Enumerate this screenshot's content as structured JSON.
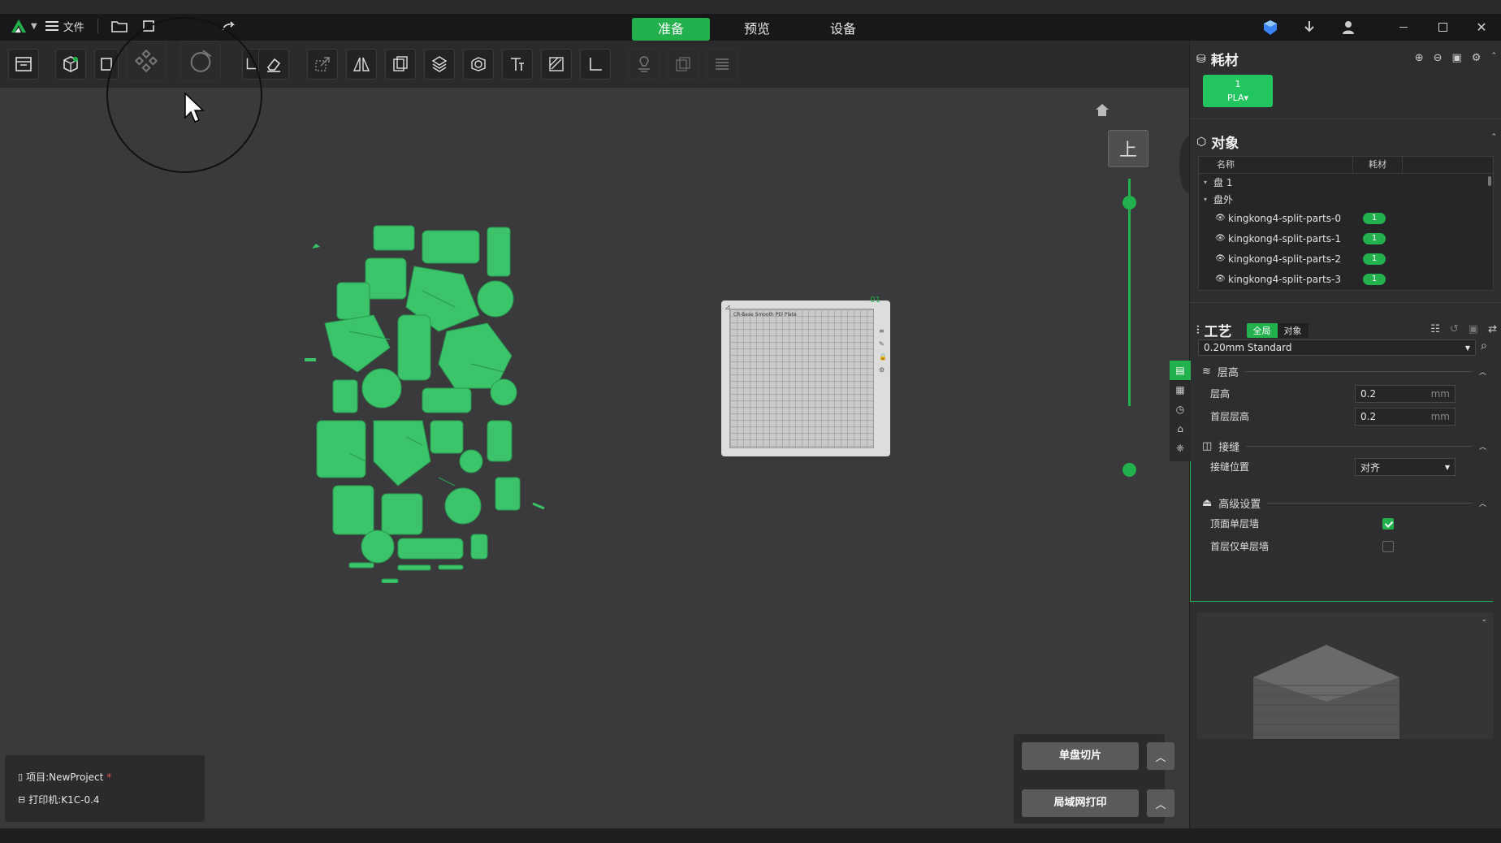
{
  "titlebar": {
    "menu_label": "文件",
    "tabs": [
      {
        "label": "准备",
        "active": true
      },
      {
        "label": "预览",
        "active": false
      },
      {
        "label": "设备",
        "active": false
      }
    ],
    "accent": "#22b14c"
  },
  "viewport": {
    "view_label": "上",
    "plate_number": "01",
    "plate_text": "CR-Base Smooth PEI Plate"
  },
  "project_info": {
    "project": "项目:NewProject",
    "modified_mark": "*",
    "printer": "打印机:K1C-0.4"
  },
  "bottom_actions": {
    "slice_label": "单盘切片",
    "print_label": "局域网打印"
  },
  "filament": {
    "title": "耗材",
    "slot_number": "1",
    "slot_type": "PLA▾",
    "slot_color": "#22c55e"
  },
  "objects": {
    "title": "对象",
    "col_name": "名称",
    "col_filament": "耗材",
    "plate1": "盘 1",
    "outside": "盘外",
    "items": [
      {
        "name": "kingkong4-split-parts-0",
        "filament": "1"
      },
      {
        "name": "kingkong4-split-parts-1",
        "filament": "1"
      },
      {
        "name": "kingkong4-split-parts-2",
        "filament": "1"
      },
      {
        "name": "kingkong4-split-parts-3",
        "filament": "1"
      }
    ]
  },
  "process": {
    "title": "工艺",
    "toggle_global": "全局",
    "toggle_object": "对象",
    "preset": "0.20mm Standard",
    "group_layer": "层高",
    "layer_height_label": "层高",
    "layer_height_value": "0.2",
    "first_layer_label": "首层层高",
    "first_layer_value": "0.2",
    "unit": "mm",
    "group_seam": "接缝",
    "seam_position_label": "接缝位置",
    "seam_position_value": "对齐",
    "group_advanced": "高级设置",
    "top_single_wall_label": "顶面单层墙",
    "top_single_wall_checked": true,
    "first_single_wall_label": "首层仅单层墙",
    "first_single_wall_checked": false
  }
}
